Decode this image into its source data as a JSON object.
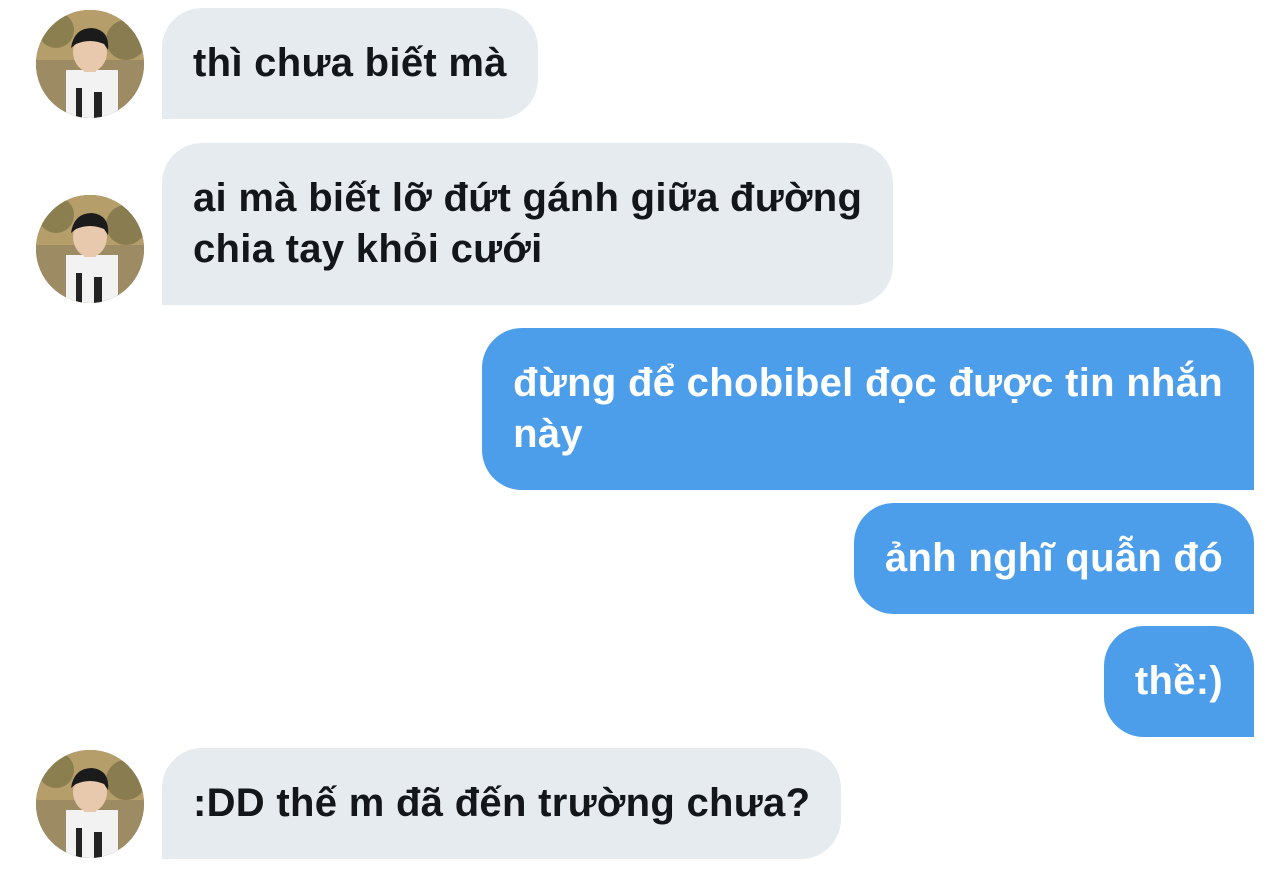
{
  "conversation": {
    "messages": [
      {
        "direction": "incoming",
        "text": "thì chưa biết mà"
      },
      {
        "direction": "incoming",
        "text": "ai mà biết lỡ đứt gánh giữa đường\nchia tay khỏi cưới"
      },
      {
        "direction": "outgoing",
        "text": "đừng để chobibel đọc được tin nhắn\nnày"
      },
      {
        "direction": "outgoing",
        "text": "ảnh nghĩ quẫn đó"
      },
      {
        "direction": "outgoing",
        "text": "thề:)"
      },
      {
        "direction": "incoming",
        "text": ":DD thế m đã đến trường chưa?"
      }
    ]
  },
  "colors": {
    "incoming_bubble": "#e6ebf0",
    "incoming_text": "#14171a",
    "outgoing_bubble": "#4c9eeb",
    "outgoing_text": "#ffffff",
    "background": "#ffffff"
  }
}
